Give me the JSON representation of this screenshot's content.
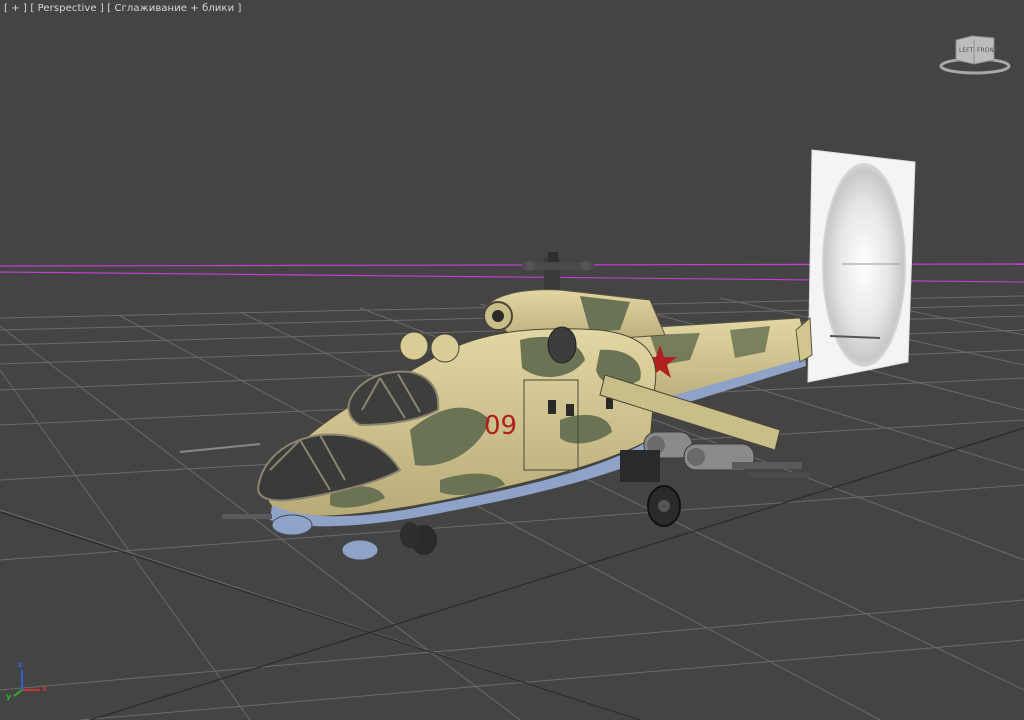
{
  "viewport": {
    "labels": {
      "plus": "[ + ]",
      "view": "[ Perspective ]",
      "shading": "[ Сглаживание + блики ]"
    }
  },
  "viewcube": {
    "face_left": "LEFT",
    "face_front": "FRONT"
  },
  "axis_gizmo": {
    "x_label": "x",
    "y_label": "y",
    "z_label": "z"
  },
  "colors": {
    "background": "#444444",
    "grid": "#6a6a6a",
    "grid_horizon": "#c040d0",
    "camo_base": "#d9cc96",
    "camo_patch": "#6b7355",
    "underbelly": "#8fa3c8",
    "marking": "#b02020"
  },
  "model": {
    "tail_number": "09"
  }
}
